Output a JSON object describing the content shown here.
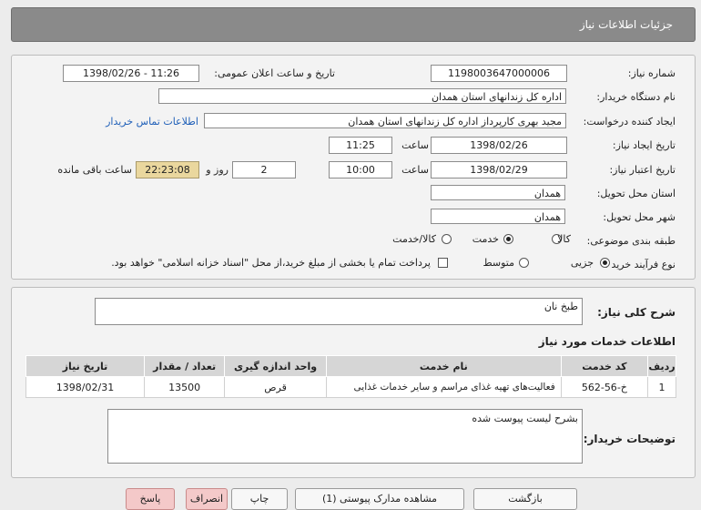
{
  "header": {
    "title": "جزئیات اطلاعات نیاز"
  },
  "form": {
    "need_no_label": "شماره نیاز:",
    "need_no": "1198003647000006",
    "announce_label": "تاریخ و ساعت اعلان عمومی:",
    "announce_value": "1398/02/26 - 11:26",
    "buyer_label": "نام دستگاه خریدار:",
    "buyer": "اداره کل زندانهای استان همدان",
    "creator_label": "ایجاد کننده درخواست:",
    "creator": "مجید بهری کارپرداز اداره کل زندانهای استان همدان",
    "contact_link": "اطلاعات تماس خریدار",
    "created_label": "تاریخ ایجاد نیاز:",
    "created_date": "1398/02/26",
    "time_label": "ساعت",
    "created_time": "11:25",
    "validity_label": "تاریخ اعتبار نیاز:",
    "validity_date": "1398/02/29",
    "validity_time": "10:00",
    "days_suffix": "روز و",
    "days": "2",
    "remaining": "22:23:08",
    "remaining_label": "ساعت باقی مانده",
    "province_label": "استان محل تحویل:",
    "province": "همدان",
    "city_label": "شهر محل تحویل:",
    "city": "همدان",
    "category_label": "طبقه بندی موضوعی:",
    "category_options": [
      "کالا",
      "خدمت",
      "کالا/خدمت"
    ],
    "category_selected": "خدمت",
    "process_label": "نوع فرآیند خرید :",
    "process_options": [
      "جزیی",
      "متوسط"
    ],
    "process_selected": "جزیی",
    "payment_note": "پرداخت تمام یا بخشی از مبلغ خرید،از محل \"اسناد خزانه اسلامی\" خواهد بود."
  },
  "summary": {
    "label": "شرح کلی نیاز:",
    "value": "طبخ نان",
    "services_title": "اطلاعات خدمات مورد نیاز"
  },
  "table": {
    "headers": [
      "ردیف",
      "کد خدمت",
      "نام خدمت",
      "واحد اندازه گیری",
      "تعداد / مقدار",
      "تاریخ نیاز"
    ],
    "rows": [
      [
        "1",
        "خ-56-562",
        "فعالیت‌های تهیه غذای مراسم و سایر خدمات غذایی",
        "قرص",
        "13500",
        "1398/02/31"
      ]
    ]
  },
  "buyer_notes": {
    "label": "توضیحات خریدار:",
    "value": "بشرح لیست پیوست شده"
  },
  "buttons": {
    "b1": "بازگشت",
    "b2": "مشاهده مدارک پیوستی (1)",
    "b3": "چاپ",
    "b4": "انصراف",
    "b5": "پاسخ"
  }
}
